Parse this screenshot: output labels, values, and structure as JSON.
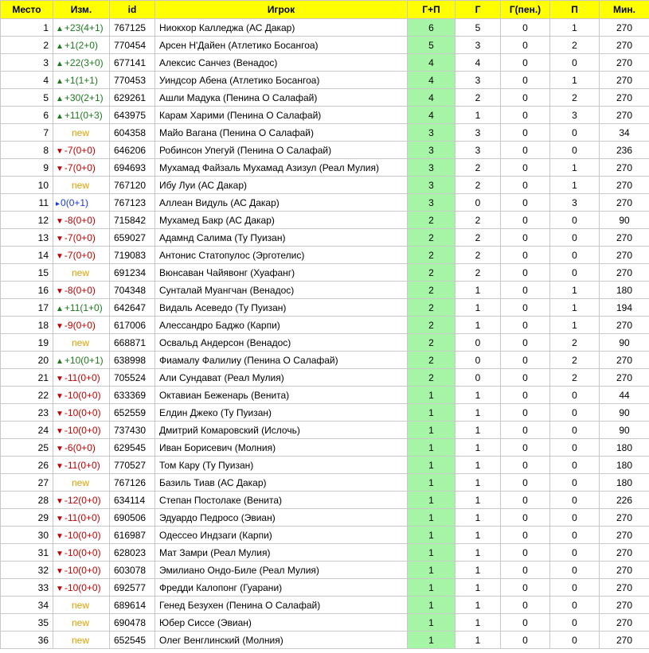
{
  "headers": [
    "Место",
    "Изм.",
    "id",
    "Игрок",
    "Г+П",
    "Г",
    "Г(пен.)",
    "П",
    "Мин."
  ],
  "colors": {
    "header_bg": "#ffff00",
    "gp_bg": "#a6f5a6",
    "up": "#1e7a1e",
    "down": "#c00000",
    "same": "#1a3ad0",
    "new": "#e0a000"
  },
  "icons": {
    "up": "triangle-up-icon",
    "down": "triangle-down-icon",
    "same": "triangle-right-icon"
  },
  "rows": [
    {
      "place": "1",
      "dir": "up",
      "change": "+23(4+1)",
      "id": "767125",
      "player": "Ниокхор Калледжа (АС Дакар)",
      "gp": "6",
      "g": "5",
      "gpen": "0",
      "p": "1",
      "min": "270"
    },
    {
      "place": "2",
      "dir": "up",
      "change": "+1(2+0)",
      "id": "770454",
      "player": "Арсен Н'Дайен (Атлетико Босангоа)",
      "gp": "5",
      "g": "3",
      "gpen": "0",
      "p": "2",
      "min": "270"
    },
    {
      "place": "3",
      "dir": "up",
      "change": "+22(3+0)",
      "id": "677141",
      "player": "Алексис Санчез (Венадос)",
      "gp": "4",
      "g": "4",
      "gpen": "0",
      "p": "0",
      "min": "270"
    },
    {
      "place": "4",
      "dir": "up",
      "change": "+1(1+1)",
      "id": "770453",
      "player": "Уиндсор Абена (Атлетико Босангоа)",
      "gp": "4",
      "g": "3",
      "gpen": "0",
      "p": "1",
      "min": "270"
    },
    {
      "place": "5",
      "dir": "up",
      "change": "+30(2+1)",
      "id": "629261",
      "player": "Ашли Мадука (Пенина О Салафай)",
      "gp": "4",
      "g": "2",
      "gpen": "0",
      "p": "2",
      "min": "270"
    },
    {
      "place": "6",
      "dir": "up",
      "change": "+11(0+3)",
      "id": "643975",
      "player": "Карам Харими (Пенина О Салафай)",
      "gp": "4",
      "g": "1",
      "gpen": "0",
      "p": "3",
      "min": "270"
    },
    {
      "place": "7",
      "dir": "new",
      "change": "new",
      "id": "604358",
      "player": "Майо Вагана (Пенина О Салафай)",
      "gp": "3",
      "g": "3",
      "gpen": "0",
      "p": "0",
      "min": "34"
    },
    {
      "place": "8",
      "dir": "down",
      "change": "-7(0+0)",
      "id": "646206",
      "player": "Робинсон Упегуй (Пенина О Салафай)",
      "gp": "3",
      "g": "3",
      "gpen": "0",
      "p": "0",
      "min": "236"
    },
    {
      "place": "9",
      "dir": "down",
      "change": "-7(0+0)",
      "id": "694693",
      "player": "Мухамад Файзаль Мухамад Азизул (Реал Мулия)",
      "gp": "3",
      "g": "2",
      "gpen": "0",
      "p": "1",
      "min": "270"
    },
    {
      "place": "10",
      "dir": "new",
      "change": "new",
      "id": "767120",
      "player": "Ибу Луи (АС Дакар)",
      "gp": "3",
      "g": "2",
      "gpen": "0",
      "p": "1",
      "min": "270"
    },
    {
      "place": "11",
      "dir": "same",
      "change": "0(0+1)",
      "id": "767123",
      "player": "Аллеан Видуль (АС Дакар)",
      "gp": "3",
      "g": "0",
      "gpen": "0",
      "p": "3",
      "min": "270"
    },
    {
      "place": "12",
      "dir": "down",
      "change": "-8(0+0)",
      "id": "715842",
      "player": "Мухамед Бакр (АС Дакар)",
      "gp": "2",
      "g": "2",
      "gpen": "0",
      "p": "0",
      "min": "90"
    },
    {
      "place": "13",
      "dir": "down",
      "change": "-7(0+0)",
      "id": "659027",
      "player": "Адамнд Салима (Ту Пуизан)",
      "gp": "2",
      "g": "2",
      "gpen": "0",
      "p": "0",
      "min": "270"
    },
    {
      "place": "14",
      "dir": "down",
      "change": "-7(0+0)",
      "id": "719083",
      "player": "Антонис Статопулос (Эрготелис)",
      "gp": "2",
      "g": "2",
      "gpen": "0",
      "p": "0",
      "min": "270"
    },
    {
      "place": "15",
      "dir": "new",
      "change": "new",
      "id": "691234",
      "player": "Вюнсаван Чайявонг (Хуафанг)",
      "gp": "2",
      "g": "2",
      "gpen": "0",
      "p": "0",
      "min": "270"
    },
    {
      "place": "16",
      "dir": "down",
      "change": "-8(0+0)",
      "id": "704348",
      "player": "Сунталай Муангчан (Венадос)",
      "gp": "2",
      "g": "1",
      "gpen": "0",
      "p": "1",
      "min": "180"
    },
    {
      "place": "17",
      "dir": "up",
      "change": "+11(1+0)",
      "id": "642647",
      "player": "Видаль Асеведо (Ту Пуизан)",
      "gp": "2",
      "g": "1",
      "gpen": "0",
      "p": "1",
      "min": "194"
    },
    {
      "place": "18",
      "dir": "down",
      "change": "-9(0+0)",
      "id": "617006",
      "player": "Алессандро Баджо (Карпи)",
      "gp": "2",
      "g": "1",
      "gpen": "0",
      "p": "1",
      "min": "270"
    },
    {
      "place": "19",
      "dir": "new",
      "change": "new",
      "id": "668871",
      "player": "Освальд Андерсон (Венадос)",
      "gp": "2",
      "g": "0",
      "gpen": "0",
      "p": "2",
      "min": "90"
    },
    {
      "place": "20",
      "dir": "up",
      "change": "+10(0+1)",
      "id": "638998",
      "player": "Фиамалу Фалилиу (Пенина О Салафай)",
      "gp": "2",
      "g": "0",
      "gpen": "0",
      "p": "2",
      "min": "270"
    },
    {
      "place": "21",
      "dir": "down",
      "change": "-11(0+0)",
      "id": "705524",
      "player": "Али Сундават (Реал Мулия)",
      "gp": "2",
      "g": "0",
      "gpen": "0",
      "p": "2",
      "min": "270"
    },
    {
      "place": "22",
      "dir": "down",
      "change": "-10(0+0)",
      "id": "633369",
      "player": "Октавиан Беженарь (Венита)",
      "gp": "1",
      "g": "1",
      "gpen": "0",
      "p": "0",
      "min": "44"
    },
    {
      "place": "23",
      "dir": "down",
      "change": "-10(0+0)",
      "id": "652559",
      "player": "Елдин Джеко (Ту Пуизан)",
      "gp": "1",
      "g": "1",
      "gpen": "0",
      "p": "0",
      "min": "90"
    },
    {
      "place": "24",
      "dir": "down",
      "change": "-10(0+0)",
      "id": "737430",
      "player": "Дмитрий Комаровский (Ислочь)",
      "gp": "1",
      "g": "1",
      "gpen": "0",
      "p": "0",
      "min": "90"
    },
    {
      "place": "25",
      "dir": "down",
      "change": "-6(0+0)",
      "id": "629545",
      "player": "Иван Борисевич (Молния)",
      "gp": "1",
      "g": "1",
      "gpen": "0",
      "p": "0",
      "min": "180"
    },
    {
      "place": "26",
      "dir": "down",
      "change": "-11(0+0)",
      "id": "770527",
      "player": "Том Кару (Ту Пуизан)",
      "gp": "1",
      "g": "1",
      "gpen": "0",
      "p": "0",
      "min": "180"
    },
    {
      "place": "27",
      "dir": "new",
      "change": "new",
      "id": "767126",
      "player": "Базиль Тиав (АС Дакар)",
      "gp": "1",
      "g": "1",
      "gpen": "0",
      "p": "0",
      "min": "180"
    },
    {
      "place": "28",
      "dir": "down",
      "change": "-12(0+0)",
      "id": "634114",
      "player": "Степан Постолаке (Венита)",
      "gp": "1",
      "g": "1",
      "gpen": "0",
      "p": "0",
      "min": "226"
    },
    {
      "place": "29",
      "dir": "down",
      "change": "-11(0+0)",
      "id": "690506",
      "player": "Эдуардо Педросо (Эвиан)",
      "gp": "1",
      "g": "1",
      "gpen": "0",
      "p": "0",
      "min": "270"
    },
    {
      "place": "30",
      "dir": "down",
      "change": "-10(0+0)",
      "id": "616987",
      "player": "Одессео Индзаги (Карпи)",
      "gp": "1",
      "g": "1",
      "gpen": "0",
      "p": "0",
      "min": "270"
    },
    {
      "place": "31",
      "dir": "down",
      "change": "-10(0+0)",
      "id": "628023",
      "player": "Мат Замри (Реал Мулия)",
      "gp": "1",
      "g": "1",
      "gpen": "0",
      "p": "0",
      "min": "270"
    },
    {
      "place": "32",
      "dir": "down",
      "change": "-10(0+0)",
      "id": "603078",
      "player": "Эмилиано Ондо-Биле (Реал Мулия)",
      "gp": "1",
      "g": "1",
      "gpen": "0",
      "p": "0",
      "min": "270"
    },
    {
      "place": "33",
      "dir": "down",
      "change": "-10(0+0)",
      "id": "692577",
      "player": "Фредди Калопонг (Гуарани)",
      "gp": "1",
      "g": "1",
      "gpen": "0",
      "p": "0",
      "min": "270"
    },
    {
      "place": "34",
      "dir": "new",
      "change": "new",
      "id": "689614",
      "player": "Генед Безухен (Пенина О Салафай)",
      "gp": "1",
      "g": "1",
      "gpen": "0",
      "p": "0",
      "min": "270"
    },
    {
      "place": "35",
      "dir": "new",
      "change": "new",
      "id": "690478",
      "player": "Юбер Сиссе (Эвиан)",
      "gp": "1",
      "g": "1",
      "gpen": "0",
      "p": "0",
      "min": "270"
    },
    {
      "place": "36",
      "dir": "new",
      "change": "new",
      "id": "652545",
      "player": "Олег Венглинский (Молния)",
      "gp": "1",
      "g": "1",
      "gpen": "0",
      "p": "0",
      "min": "270"
    }
  ]
}
